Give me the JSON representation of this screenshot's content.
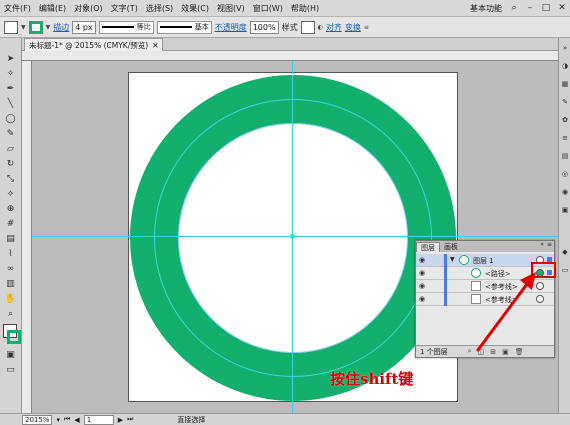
{
  "menubar": {
    "items": [
      "文件(F)",
      "编辑(E)",
      "对象(O)",
      "文字(T)",
      "选择(S)",
      "效果(C)",
      "视图(V)",
      "窗口(W)",
      "帮助(H)"
    ],
    "workspace": "基本功能"
  },
  "controlbar": {
    "stroke_label": "描边",
    "stroke_value": "4 px",
    "profile_label": "等比",
    "brush_label": "基本",
    "opacity_label": "不透明度",
    "opacity_value": "100%",
    "style_label": "样式",
    "align_label": "对齐",
    "transform_label": "变换",
    "colors": {
      "stroke": "#13b06d"
    }
  },
  "document": {
    "tab_title": "未标题-1* @ 2015% (CMYK/预览)"
  },
  "artwork": {
    "ring_color": "#13b06d",
    "guide_color": "#33d6e0"
  },
  "layers_panel": {
    "tabs": [
      "图层",
      "画板"
    ],
    "rows": [
      {
        "name": "图层 1"
      },
      {
        "name": "<路径>"
      },
      {
        "name": "<参考线>"
      },
      {
        "name": "<参考线>"
      }
    ],
    "footer": "1 个图层"
  },
  "annotation": {
    "text": "按住shift键",
    "color": "#d40000"
  },
  "statusbar": {
    "zoom": "2015%",
    "page": "1",
    "tool": "直接选择"
  }
}
